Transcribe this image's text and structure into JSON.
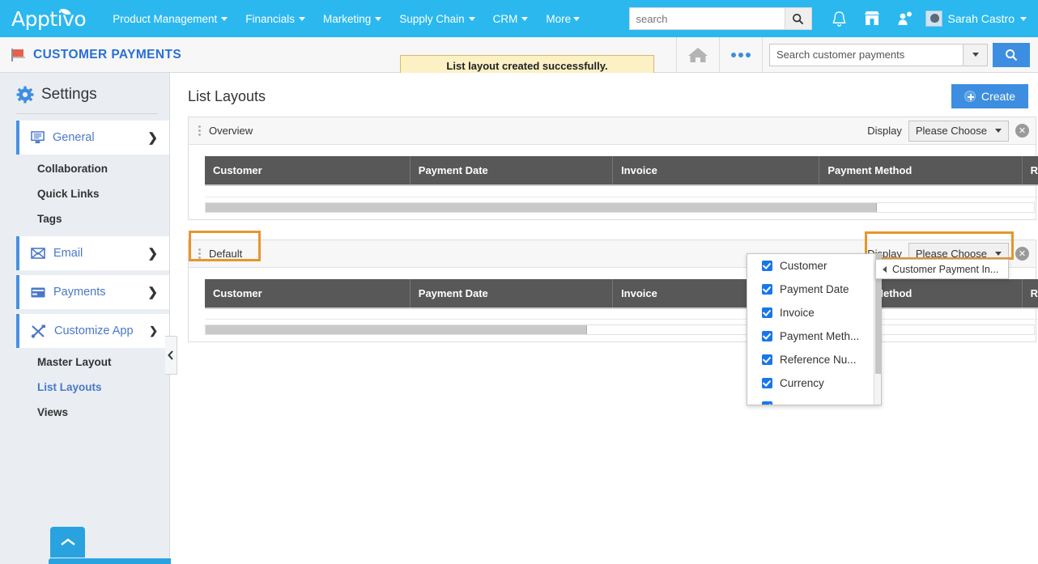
{
  "topnav": {
    "logo": "Apptivo",
    "menus": [
      {
        "label": "Product Management"
      },
      {
        "label": "Financials"
      },
      {
        "label": "Marketing"
      },
      {
        "label": "Supply Chain"
      },
      {
        "label": "CRM"
      },
      {
        "label": "More"
      }
    ],
    "search_placeholder": "search",
    "search_value": "",
    "icons": [
      "bell-icon",
      "store-icon",
      "people-icon"
    ],
    "user_name": "Sarah Castro",
    "brand_color": "#2ab8ef"
  },
  "appbar": {
    "app_title": "CUSTOMER PAYMENTS",
    "toast_message": "List layout created successfully.",
    "search_placeholder": "Search customer payments",
    "search_value": ""
  },
  "sidebar": {
    "heading": "Settings",
    "groups": [
      {
        "label": "General",
        "icon": "monitor-icon",
        "expanded": true,
        "children": [
          {
            "label": "Collaboration",
            "active": false
          },
          {
            "label": "Quick Links",
            "active": false
          },
          {
            "label": "Tags",
            "active": false
          }
        ]
      },
      {
        "label": "Email",
        "icon": "envelope-icon",
        "expanded": false,
        "children": []
      },
      {
        "label": "Payments",
        "icon": "creditcard-icon",
        "expanded": false,
        "children": []
      },
      {
        "label": "Customize App",
        "icon": "tools-icon",
        "expanded": true,
        "children": [
          {
            "label": "Master Layout",
            "active": false
          },
          {
            "label": "List Layouts",
            "active": true
          },
          {
            "label": "Views",
            "active": false
          }
        ]
      }
    ]
  },
  "main": {
    "page_title": "List Layouts",
    "create_label": "Create",
    "panels": [
      {
        "title": "Overview",
        "display_label": "Display",
        "display_value": "Please Choose",
        "highlighted": false,
        "columns": [
          "Customer",
          "Payment Date",
          "Invoice",
          "Payment Method",
          "Reference Number"
        ],
        "scroll_fraction": 0.81
      },
      {
        "title": "Default",
        "display_label": "Display",
        "display_value": "Please Choose",
        "highlighted": true,
        "columns": [
          "Customer",
          "Payment Date",
          "Invoice",
          "Payment Method",
          "Reference Number"
        ],
        "scroll_fraction": 0.46
      }
    ]
  },
  "dropdown": {
    "items": [
      {
        "label": "Customer",
        "checked": true
      },
      {
        "label": "Payment Date",
        "checked": true
      },
      {
        "label": "Invoice",
        "checked": true
      },
      {
        "label": "Payment Meth...",
        "checked": true
      },
      {
        "label": "Reference Nu...",
        "checked": true
      },
      {
        "label": "Currency",
        "checked": true
      }
    ],
    "submenu_label": "Customer Payment In..."
  },
  "accent": {
    "highlight_ring": "#e8952d",
    "blue": "#3d8ee0",
    "link_blue": "#4a78c8",
    "header_gray": "#585858"
  }
}
